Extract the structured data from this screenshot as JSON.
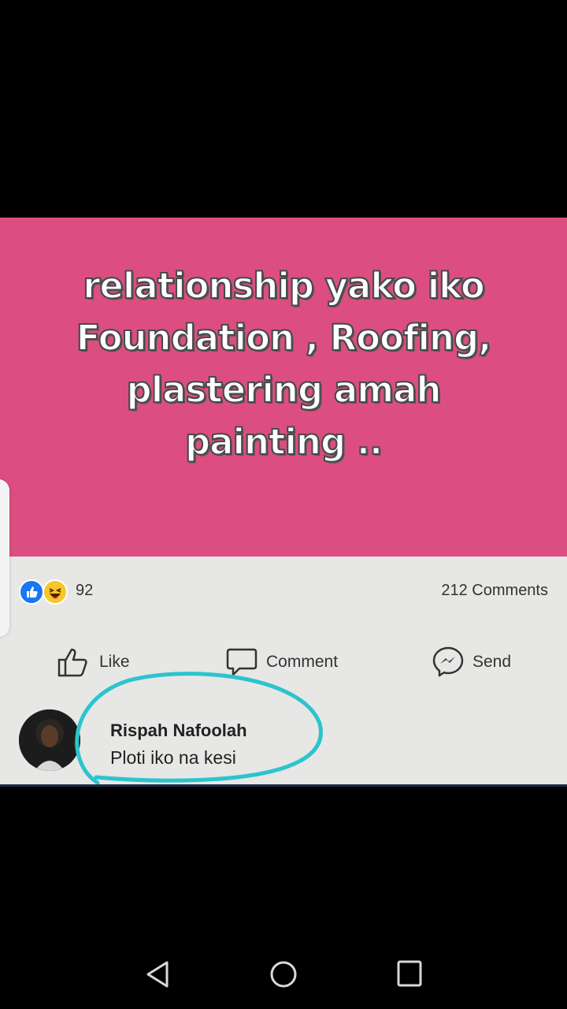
{
  "post": {
    "meme_lines": [
      "relationship yako iko",
      "Foundation , Roofing,",
      "plastering amah",
      "painting .."
    ],
    "background_color": "#dc4e82"
  },
  "stats": {
    "reaction_count": "92",
    "comments_count": "212 Comments",
    "reaction_icons": [
      "like-icon",
      "haha-icon"
    ]
  },
  "actions": {
    "like_label": "Like",
    "comment_label": "Comment",
    "send_label": "Send"
  },
  "comment": {
    "author": "Rispah Nafoolah",
    "text": "Ploti iko na kesi",
    "highlight_color": "#2cc4cc"
  },
  "navbar": {
    "icons": [
      "back-icon",
      "home-icon",
      "recents-icon"
    ]
  }
}
